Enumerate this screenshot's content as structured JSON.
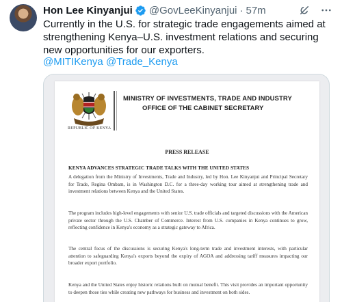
{
  "author": {
    "name": "Hon Lee Kinyanjui",
    "handle": "@GovLeeKinyanjui",
    "separator": "·",
    "time": "57m"
  },
  "tweet": {
    "text": "Currently in the U.S. for strategic trade engagements aimed at strengthening Kenya–U.S. investment relations and securing new opportunities for our exporters.",
    "mentions": [
      "@MITIKenya",
      "@Trade_Kenya"
    ]
  },
  "icons": {
    "verified": "verified-badge-icon",
    "grok": "grok-icon",
    "more": "more-icon"
  },
  "colors": {
    "accent": "#1d9bf0",
    "text": "#0f1419",
    "secondary": "#536471"
  },
  "document": {
    "emblem_caption": "REPUBLIC OF KENYA",
    "ministry": "MINISTRY OF INVESTMENTS, TRADE AND INDUSTRY",
    "office": "OFFICE OF THE CABINET SECRETARY",
    "press_label": "PRESS RELEASE",
    "headline": "KENYA ADVANCES STRATEGIC TRADE TALKS WITH THE UNITED STATES",
    "paragraphs": [
      "A delegation from the Ministry of Investments, Trade and Industry, led by Hon. Lee Kinyanjui and Principal Secretary for Trade, Regina Ombam, is in Washington D.C. for a three-day working tour aimed at strengthening trade and investment relations between Kenya and the United States.",
      "The program includes high-level engagements with senior U.S. trade officials and targeted discussions with the American private sector through the U.S. Chamber of Commerce. Interest from U.S. companies in Kenya continues to grow, reflecting confidence in Kenya's economy as a strategic gateway to Africa.",
      "The central focus of the discussions is securing Kenya's long-term trade and investment interests, with particular attention to safeguarding Kenya's exports beyond the expiry of AGOA and addressing tariff measures impacting our broader export portfolio.",
      "Kenya and the United States enjoy historic relations built on mutual benefit. This visit provides an important opportunity to deepen those ties while creating new pathways for business and investment on both sides."
    ]
  }
}
